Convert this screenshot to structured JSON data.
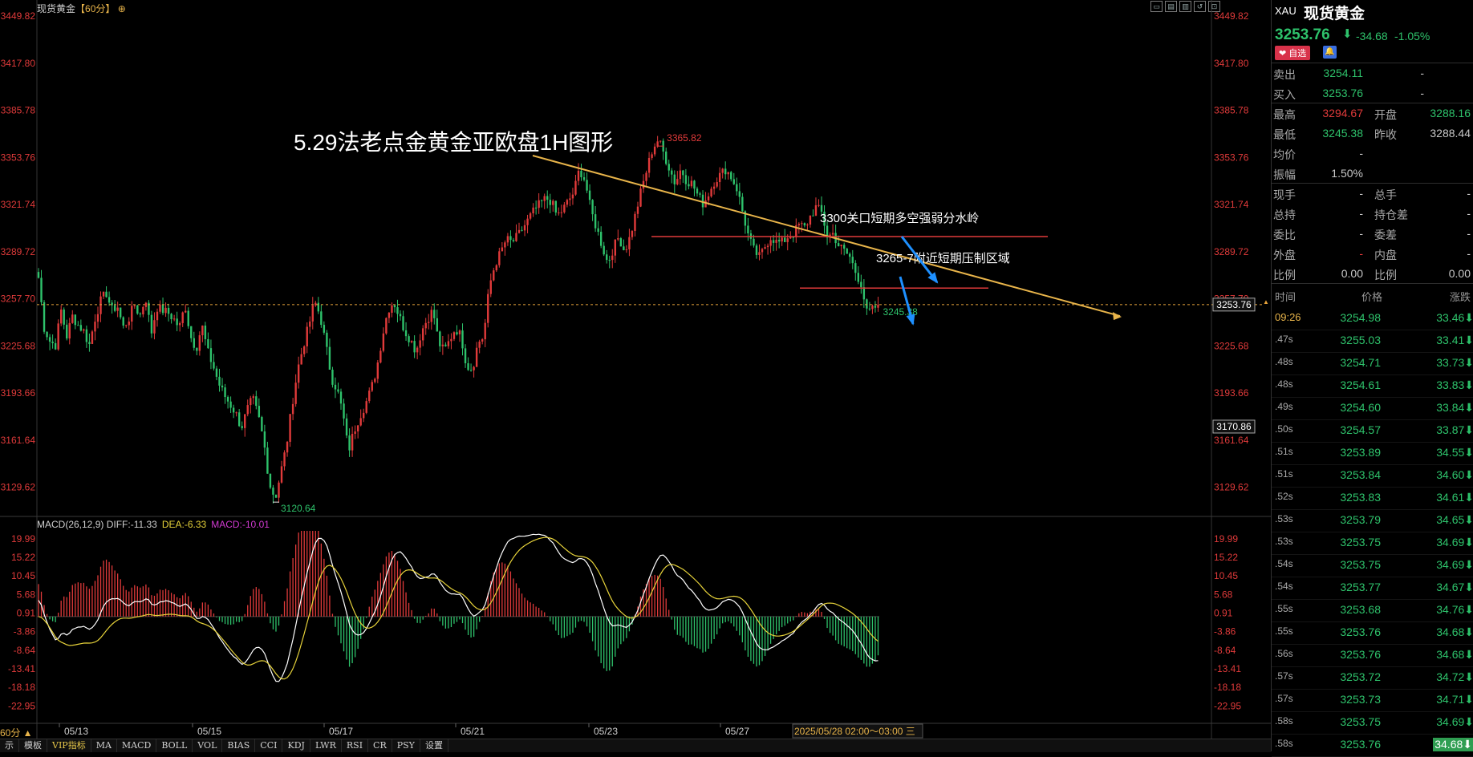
{
  "header": {
    "instrument": "现货黄金",
    "period": "【60分】",
    "tool_icons": [
      "minimize-icon",
      "maximize-icon",
      "restore-icon",
      "reset-icon",
      "close-icon"
    ]
  },
  "annotations": {
    "title": "5.29法老点金黄金亚欧盘1H图形",
    "line1": "3300关口短期多空强弱分水岭",
    "line2": "3265-7附近短期压制区域",
    "high_label": "3365.82",
    "low_label": "3120.64",
    "recent_low_label": "3245.38",
    "current_price_tag": "3253.76",
    "crosshair_tag": "3170.86",
    "crosshair_date": "2025/05/28 02:00～03:00 三"
  },
  "macd_legend": {
    "name": "MACD(26,12,9)",
    "diff": "DIFF:-11.33",
    "dea": "DEA:-6.33",
    "macd": "MACD:-10.01"
  },
  "chart_data": [
    {
      "type": "candlestick",
      "title": "现货黄金【60分】",
      "y_ticks": [
        "3449.82",
        "3417.80",
        "3385.78",
        "3353.76",
        "3321.74",
        "3289.72",
        "3257.70",
        "3225.68",
        "3193.66",
        "3161.64",
        "3129.62"
      ],
      "x_ticks": [
        "05/13",
        "05/15",
        "05/17",
        "05/21",
        "05/23",
        "05/27"
      ],
      "ylim": [
        3112,
        3449.82
      ],
      "colors": {
        "up": "#e03a3a",
        "down": "#2ec26b",
        "trendline": "#e8b44a",
        "zone": "#e03a3a",
        "arrow": "#1e90ff"
      },
      "key_points": [
        {
          "label": "high",
          "value": 3365.82
        },
        {
          "label": "low",
          "value": 3120.64
        },
        {
          "label": "recent_low",
          "value": 3245.38
        }
      ],
      "resistance_levels": [
        3300,
        3265
      ],
      "last_price": 3253.76,
      "trendline": {
        "from": 3355,
        "to": 3246
      },
      "path": [
        3272,
        3238,
        3229,
        3226,
        3250,
        3232,
        3246,
        3240,
        3236,
        3226,
        3244,
        3256,
        3262,
        3250,
        3253,
        3238,
        3244,
        3254,
        3246,
        3259,
        3234,
        3252,
        3250,
        3248,
        3244,
        3238,
        3254,
        3232,
        3224,
        3240,
        3222,
        3212,
        3200,
        3192,
        3186,
        3180,
        3170,
        3182,
        3190,
        3178,
        3160,
        3132,
        3122,
        3140,
        3158,
        3186,
        3210,
        3226,
        3240,
        3256,
        3246,
        3226,
        3204,
        3196,
        3180,
        3154,
        3168,
        3178,
        3186,
        3196,
        3210,
        3232,
        3250,
        3256,
        3246,
        3236,
        3230,
        3222,
        3236,
        3244,
        3250,
        3228,
        3222,
        3230,
        3238,
        3232,
        3212,
        3210,
        3228,
        3232,
        3266,
        3281,
        3289,
        3298,
        3296,
        3300,
        3306,
        3312,
        3318,
        3322,
        3326,
        3324,
        3314,
        3318,
        3324,
        3330,
        3346,
        3338,
        3318,
        3306,
        3294,
        3282,
        3292,
        3300,
        3290,
        3300,
        3316,
        3332,
        3346,
        3360,
        3366,
        3356,
        3346,
        3336,
        3346,
        3338,
        3336,
        3328,
        3322,
        3330,
        3338,
        3342,
        3346,
        3340,
        3332,
        3316,
        3300,
        3290,
        3286,
        3294,
        3300,
        3296,
        3296,
        3300,
        3302,
        3308,
        3306,
        3314,
        3320,
        3316,
        3300,
        3302,
        3294,
        3290,
        3286,
        3276,
        3268,
        3248,
        3250,
        3254
      ],
      "close": 3253.76
    },
    {
      "type": "bar+line",
      "title": "MACD(26,12,9)",
      "y_ticks": [
        "19.99",
        "15.22",
        "10.45",
        "5.68",
        "0.91",
        "-3.86",
        "-8.64",
        "-13.41",
        "-18.18",
        "-22.95"
      ],
      "ylim": [
        -27,
        22
      ],
      "series": [
        {
          "name": "DIFF",
          "last": -11.33
        },
        {
          "name": "DEA",
          "last": -6.33
        },
        {
          "name": "MACD",
          "last": -10.01
        }
      ]
    }
  ],
  "sidebar": {
    "code": "XAU",
    "name": "现货黄金",
    "price": "3253.76",
    "arrow": "⬇",
    "change": "-34.68",
    "change_pct": "-1.05%",
    "fav_label": "❤ 自选",
    "bell": "🔔",
    "quotes": [
      {
        "l1": "卖出",
        "v1": "3254.11",
        "l2": "",
        "v2": "-",
        "c1": "#2ec26b",
        "c2": "#c8c8c8"
      },
      {
        "l1": "买入",
        "v1": "3253.76",
        "l2": "",
        "v2": "-",
        "c1": "#2ec26b",
        "c2": "#c8c8c8"
      },
      {
        "l1": "最高",
        "v1": "3294.67",
        "l2": "开盘",
        "v2": "3288.16",
        "c1": "#e03a3a",
        "c2": "#2ec26b"
      },
      {
        "l1": "最低",
        "v1": "3245.38",
        "l2": "昨收",
        "v2": "3288.44",
        "c1": "#2ec26b",
        "c2": "#c8c8c8"
      },
      {
        "l1": "均价",
        "v1": "-",
        "l2": "",
        "v2": "",
        "c1": "#c8c8c8",
        "c2": "#c8c8c8"
      },
      {
        "l1": "振幅",
        "v1": "1.50%",
        "l2": "",
        "v2": "",
        "c1": "#c8c8c8",
        "c2": "#c8c8c8"
      },
      {
        "l1": "现手",
        "v1": "-",
        "l2": "总手",
        "v2": "-",
        "c1": "#c8c8c8",
        "c2": "#c8c8c8"
      },
      {
        "l1": "总持",
        "v1": "-",
        "l2": "持仓差",
        "v2": "-",
        "c1": "#c8c8c8",
        "c2": "#c8c8c8"
      },
      {
        "l1": "委比",
        "v1": "-",
        "l2": "委差",
        "v2": "-",
        "c1": "#c8c8c8",
        "c2": "#c8c8c8"
      },
      {
        "l1": "外盘",
        "v1": "-",
        "l2": "内盘",
        "v2": "-",
        "c1": "#e03a3a",
        "c2": "#c8c8c8"
      },
      {
        "l1": "比例",
        "v1": "0.00",
        "l2": "比例",
        "v2": "0.00",
        "c1": "#c8c8c8",
        "c2": "#c8c8c8"
      }
    ],
    "table_headers": [
      "时间",
      "价格",
      "涨跌"
    ],
    "ticks": [
      {
        "t": "09:26",
        "p": "3254.98",
        "c": "33.46⬇"
      },
      {
        "t": ".47s",
        "p": "3255.03",
        "c": "33.41⬇"
      },
      {
        "t": ".48s",
        "p": "3254.71",
        "c": "33.73⬇"
      },
      {
        "t": ".48s",
        "p": "3254.61",
        "c": "33.83⬇"
      },
      {
        "t": ".49s",
        "p": "3254.60",
        "c": "33.84⬇"
      },
      {
        "t": ".50s",
        "p": "3254.57",
        "c": "33.87⬇"
      },
      {
        "t": ".51s",
        "p": "3253.89",
        "c": "34.55⬇"
      },
      {
        "t": ".51s",
        "p": "3253.84",
        "c": "34.60⬇"
      },
      {
        "t": ".52s",
        "p": "3253.83",
        "c": "34.61⬇"
      },
      {
        "t": ".53s",
        "p": "3253.79",
        "c": "34.65⬇"
      },
      {
        "t": ".53s",
        "p": "3253.75",
        "c": "34.69⬇"
      },
      {
        "t": ".54s",
        "p": "3253.75",
        "c": "34.69⬇"
      },
      {
        "t": ".54s",
        "p": "3253.77",
        "c": "34.67⬇"
      },
      {
        "t": ".55s",
        "p": "3253.68",
        "c": "34.76⬇"
      },
      {
        "t": ".55s",
        "p": "3253.76",
        "c": "34.68⬇"
      },
      {
        "t": ".56s",
        "p": "3253.76",
        "c": "34.68⬇"
      },
      {
        "t": ".57s",
        "p": "3253.72",
        "c": "34.72⬇"
      },
      {
        "t": ".57s",
        "p": "3253.73",
        "c": "34.71⬇"
      },
      {
        "t": ".58s",
        "p": "3253.75",
        "c": "34.69⬇"
      },
      {
        "t": ".58s",
        "p": "3253.76",
        "c": "34.68⬇"
      }
    ]
  },
  "bottom": {
    "period_label": "60分 ▲",
    "tabs": [
      "示",
      "模板",
      "VIP指标",
      "MA",
      "MACD",
      "BOLL",
      "VOL",
      "BIAS",
      "CCI",
      "KDJ",
      "LWR",
      "RSI",
      "CR",
      "PSY",
      "设置"
    ]
  }
}
